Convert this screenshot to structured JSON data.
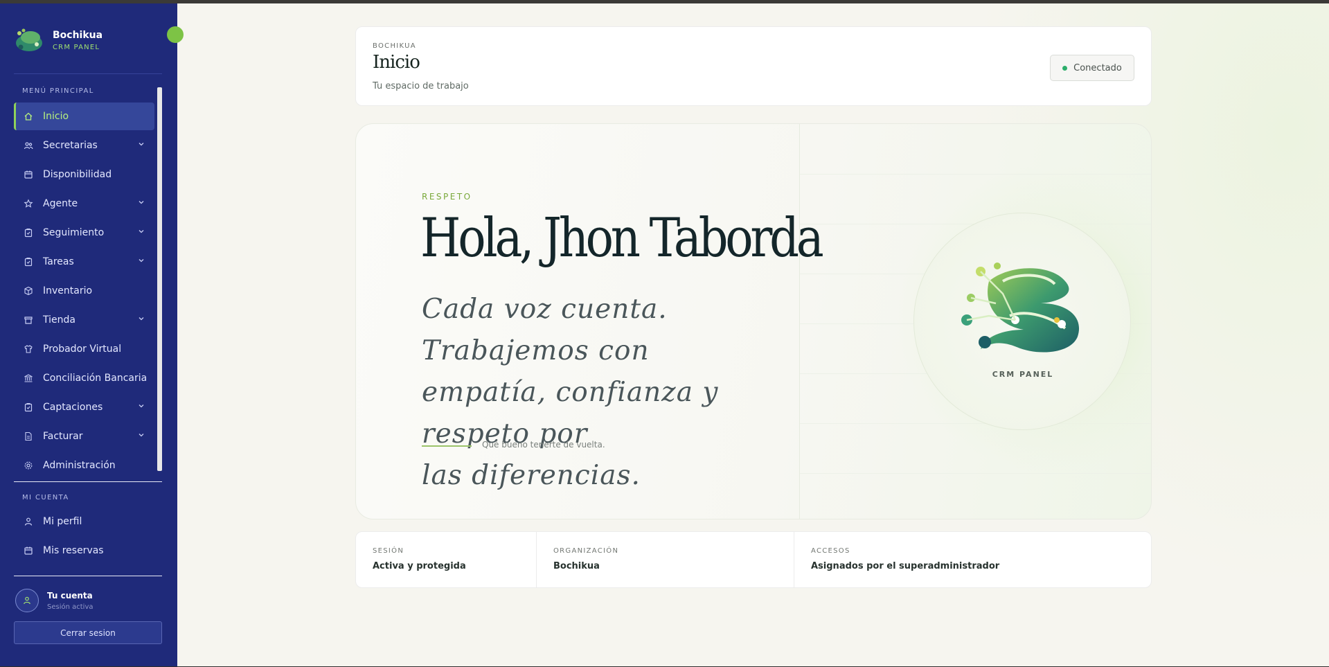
{
  "brand": {
    "name": "Bochikua",
    "subtitle": "CRM PANEL"
  },
  "sidebar": {
    "main_label": "MENÚ PRINCIPAL",
    "items": [
      {
        "label": "Inicio",
        "icon": "home-icon",
        "active": true,
        "expandable": false
      },
      {
        "label": "Secretarias",
        "icon": "users-icon",
        "active": false,
        "expandable": true
      },
      {
        "label": "Disponibilidad",
        "icon": "calendar-icon",
        "active": false,
        "expandable": false
      },
      {
        "label": "Agente",
        "icon": "star-icon",
        "active": false,
        "expandable": true
      },
      {
        "label": "Seguimiento",
        "icon": "clipboard-icon",
        "active": false,
        "expandable": true
      },
      {
        "label": "Tareas",
        "icon": "clipboard-icon",
        "active": false,
        "expandable": true
      },
      {
        "label": "Inventario",
        "icon": "box-icon",
        "active": false,
        "expandable": false
      },
      {
        "label": "Tienda",
        "icon": "store-icon",
        "active": false,
        "expandable": true
      },
      {
        "label": "Probador Virtual",
        "icon": "shirt-icon",
        "active": false,
        "expandable": false
      },
      {
        "label": "Conciliación Bancaria",
        "icon": "bank-icon",
        "active": false,
        "expandable": false
      },
      {
        "label": "Captaciones",
        "icon": "clipboard-icon",
        "active": false,
        "expandable": true
      },
      {
        "label": "Facturar",
        "icon": "document-icon",
        "active": false,
        "expandable": true
      },
      {
        "label": "Administración",
        "icon": "gear-icon",
        "active": false,
        "expandable": false
      }
    ],
    "account_label": "MI CUENTA",
    "account_items": [
      {
        "label": "Mi perfil",
        "icon": "user-icon"
      },
      {
        "label": "Mis reservas",
        "icon": "calendar-icon"
      }
    ],
    "account": {
      "name": "Tu cuenta",
      "status": "Sesión activa"
    },
    "logout_label": "Cerrar sesion"
  },
  "header": {
    "kicker": "BOCHIKUA",
    "title": "Inicio",
    "subtitle": "Tu espacio de trabajo",
    "status": "Conectado",
    "status_color": "#2cae6b"
  },
  "hero": {
    "kicker": "RESPETO",
    "greeting": "Hola, Jhon Taborda",
    "quote_lines": [
      "Cada voz cuenta. Trabajemos con",
      "empatía, confianza y respeto por",
      "las diferencias."
    ],
    "note": "Qué bueno tenerte de vuelta.",
    "emblem_caption": "CRM PANEL"
  },
  "info": [
    {
      "key": "SESIÓN",
      "value": "Activa y protegida"
    },
    {
      "key": "ORGANIZACIÓN",
      "value": "Bochikua"
    },
    {
      "key": "ACCESOS",
      "value": "Asignados por el superadministrador"
    }
  ],
  "colors": {
    "sidebar_bg": "#1f2a7a",
    "accent_green": "#8fd25a",
    "text_dark": "#14262a"
  }
}
